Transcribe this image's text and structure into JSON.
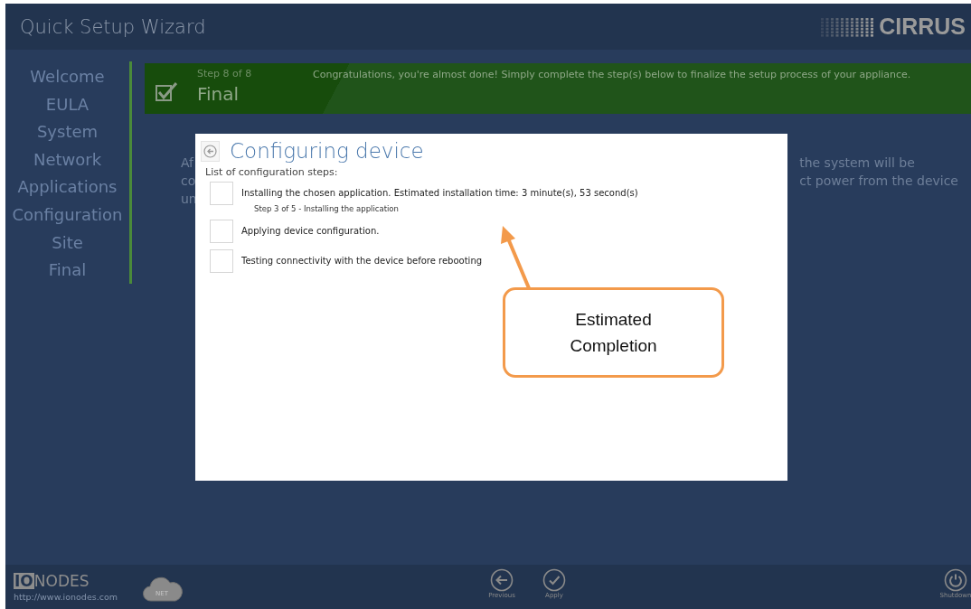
{
  "window": {
    "title": "Quick Setup Wizard",
    "logo": "CIRRUS"
  },
  "sidebar": {
    "items": [
      "Welcome",
      "EULA",
      "System",
      "Network",
      "Applications",
      "Configuration",
      "Site",
      "Final"
    ]
  },
  "banner": {
    "step": "Step 8 of 8",
    "title": "Final",
    "message": "Congratulations, you're almost done!  Simply complete the step(s) below to finalize the setup process of your appliance."
  },
  "background_text": {
    "left": [
      "Af",
      "co",
      "un"
    ],
    "right": [
      "the system will be",
      "ct power from the device"
    ]
  },
  "dialog": {
    "title": "Configuring device",
    "subtitle": "List of configuration steps:",
    "steps": [
      {
        "label": "Installing the chosen application. Estimated installation time: 3 minute(s), 53 second(s)",
        "detail": "Step 3 of 5 - Installing the application",
        "checked": false
      },
      {
        "label": "Applying device configuration.",
        "checked": false
      },
      {
        "label": "Testing connectivity with the device before rebooting",
        "checked": false
      }
    ]
  },
  "callout": {
    "text": "Estimated Completion"
  },
  "footer": {
    "brand_box": "IO",
    "brand": "NODES",
    "url": "http://www.ionodes.com",
    "cloud_label": "NET",
    "buttons": [
      {
        "kind": "previous",
        "label": "Previous"
      },
      {
        "kind": "apply",
        "label": "Apply"
      }
    ],
    "shutdown": {
      "label": "Shutdown"
    }
  }
}
